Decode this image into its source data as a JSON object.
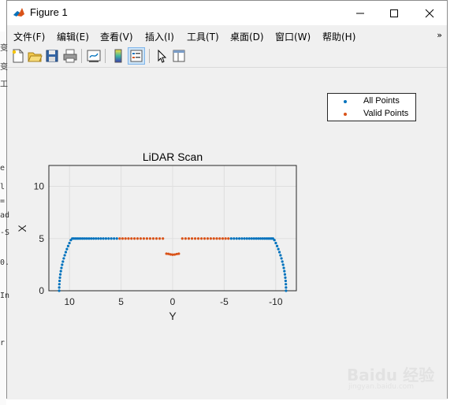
{
  "window": {
    "title": "Figure 1"
  },
  "menu": {
    "items": [
      "文件(F)",
      "编辑(E)",
      "查看(V)",
      "插入(I)",
      "工具(T)",
      "桌面(D)",
      "窗口(W)",
      "帮助(H)"
    ],
    "overflow": "»"
  },
  "toolbar": {
    "icons": [
      "new-figure-icon",
      "open-file-icon",
      "save-icon",
      "print-icon",
      "link-plot-icon",
      "insert-colorbar-icon",
      "insert-legend-icon",
      "edit-plot-icon",
      "property-inspector-icon"
    ]
  },
  "legend": {
    "entries": [
      {
        "label": "All Points",
        "color": "#0072bd"
      },
      {
        "label": "Valid Points",
        "color": "#d95319"
      }
    ]
  },
  "chart_data": {
    "type": "scatter",
    "title": "LiDAR Scan",
    "xlabel": "Y",
    "ylabel": "X",
    "xlim": [
      12,
      -12
    ],
    "ylim": [
      0,
      12
    ],
    "x_reversed": true,
    "xticks": [
      10,
      5,
      0,
      -5,
      -10
    ],
    "yticks": [
      0,
      5,
      10
    ],
    "grid": true,
    "legend_position": "top-right",
    "series": [
      {
        "name": "All Points",
        "color": "#0072bd",
        "description": "semi-circular arc of radius 11 spanning Y from 11 to -11",
        "arc": {
          "radius": 11,
          "angle_min_deg": 0,
          "angle_max_deg": 180,
          "count": 110,
          "gap_from": 0.75,
          "gap_to": -0.75
        }
      },
      {
        "name": "Valid Points",
        "color": "#d95319",
        "upper_arc_y_ranges": [
          [
            5.2,
            0.9
          ],
          [
            -0.9,
            -5.5
          ]
        ],
        "center_points": {
          "x": 3.5,
          "y_range": [
            0.6,
            -0.6
          ],
          "count": 7
        }
      }
    ]
  },
  "background_text": [
    "变",
    "变",
    "工",
    "e",
    "l",
    "=",
    "ad",
    "-S",
    "0.",
    "In",
    "r"
  ],
  "watermark": {
    "brand": "Baidu 经验",
    "domain": "jingyan.baidu.com"
  }
}
